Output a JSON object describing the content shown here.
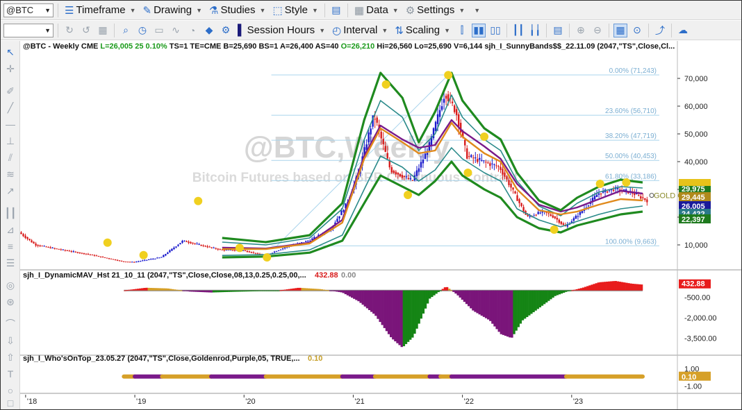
{
  "toolbar": {
    "symbol": "@BTC",
    "menus": [
      "Timeframe",
      "Drawing",
      "Studies",
      "Style",
      "Data",
      "Settings"
    ],
    "row2": [
      "Session Hours",
      "Interval",
      "Scaling"
    ]
  },
  "chart_data": [
    {
      "type": "line",
      "panel": "price",
      "watermark_title": "@BTC,Weekly",
      "watermark_subtitle": "Bitcoin Futures based on BRR Continuous Contract...",
      "header": {
        "symbol": "@BTC - Weekly  CME",
        "L": "L=26,005",
        "chg": "25",
        "pct": "0.10%",
        "rest": "TS=1  TE=CME  B=25,690  BS=1  A=26,400  AS=40",
        "O": "O=26,210",
        "tail": "Hi=26,560  Lo=25,690  V=6,144  sjh_I_SunnyBands$$_22.11.09 (2047,\"TS\",Close,Cl..."
      },
      "ylim": [
        3500,
        80000
      ],
      "y_ticks": [
        10000,
        20000,
        30000,
        40000,
        50000,
        60000,
        70000
      ],
      "y_tick_labels": [
        "10,000",
        "20,000",
        "30,000",
        "40,000",
        "50,000",
        "60,000",
        "70,000"
      ],
      "x_tick_labels": [
        "'18",
        "'19",
        "'20",
        "'21",
        "'22",
        "'23"
      ],
      "x_ticks": [
        2018.0,
        2019.0,
        2020.0,
        2021.0,
        2022.0,
        2023.0
      ],
      "xlim": [
        2017.95,
        2023.93
      ],
      "fib_levels": [
        {
          "label": "0.00% (71,243)",
          "value": 71243
        },
        {
          "label": "23.60% (56,710)",
          "value": 56710
        },
        {
          "label": "38.20% (47,719)",
          "value": 47719
        },
        {
          "label": "50.00% (40,453)",
          "value": 40453
        },
        {
          "label": "61.80% (33,186)",
          "value": 33186
        },
        {
          "label": "100.00% (9,663)",
          "value": 9663
        }
      ],
      "fib_start_x": 2020.25,
      "price_path": {
        "x": [
          2017.95,
          2018.1,
          2018.3,
          2018.6,
          2018.9,
          2019.0,
          2019.25,
          2019.45,
          2019.6,
          2019.8,
          2020.0,
          2020.2,
          2020.4,
          2020.6,
          2020.8,
          2020.95,
          2021.05,
          2021.2,
          2021.35,
          2021.45,
          2021.55,
          2021.7,
          2021.85,
          2021.95,
          2022.05,
          2022.2,
          2022.35,
          2022.45,
          2022.6,
          2022.75,
          2022.85,
          2022.95,
          2023.1,
          2023.25,
          2023.4,
          2023.55,
          2023.7
        ],
        "y": [
          14500,
          10000,
          8500,
          6500,
          4000,
          3800,
          5500,
          11500,
          10000,
          8200,
          8000,
          6200,
          9300,
          11500,
          15500,
          25000,
          35000,
          57000,
          37000,
          35000,
          33000,
          45000,
          65000,
          58000,
          42000,
          40000,
          38000,
          31000,
          20000,
          22000,
          20000,
          16500,
          22000,
          28500,
          30200,
          29000,
          26005
        ]
      },
      "bands": {
        "x": [
          2019.8,
          2020.2,
          2020.6,
          2020.9,
          2021.1,
          2021.25,
          2021.45,
          2021.6,
          2021.75,
          2021.9,
          2022.0,
          2022.2,
          2022.35,
          2022.5,
          2022.7,
          2022.9,
          2023.05,
          2023.25,
          2023.45,
          2023.65
        ],
        "upper2": [
          12500,
          11000,
          13500,
          25000,
          55000,
          72000,
          63000,
          47000,
          58000,
          72000,
          62000,
          52000,
          48000,
          36000,
          26000,
          22500,
          27000,
          31000,
          33500,
          32500
        ],
        "upper1": [
          11000,
          10000,
          12500,
          23000,
          48000,
          62000,
          56000,
          44000,
          50000,
          64000,
          56000,
          48000,
          44000,
          33000,
          24000,
          20500,
          25000,
          29000,
          31000,
          30500
        ],
        "mid_purple": [
          9000,
          8700,
          10800,
          19000,
          42000,
          53000,
          48000,
          45000,
          46000,
          55000,
          51000,
          45500,
          41000,
          32000,
          24500,
          22000,
          23500,
          26500,
          29500,
          28500
        ],
        "mid_orange": [
          8500,
          8500,
          10500,
          18000,
          41000,
          52000,
          47000,
          43000,
          44000,
          54000,
          49000,
          43000,
          40000,
          30000,
          22500,
          21000,
          22000,
          24500,
          26500,
          26000
        ],
        "lower1": [
          6200,
          6500,
          8200,
          13500,
          30000,
          42000,
          38000,
          33000,
          37000,
          45000,
          41000,
          36000,
          33000,
          23000,
          19000,
          16500,
          18500,
          21000,
          23000,
          24000
        ],
        "lower2": [
          5500,
          5800,
          7200,
          11500,
          25000,
          35000,
          31000,
          28000,
          33000,
          40000,
          35000,
          30000,
          27000,
          20000,
          16000,
          14500,
          17000,
          19000,
          21000,
          22000
        ]
      },
      "markers": [
        {
          "x": 2018.75,
          "y": 10800
        },
        {
          "x": 2019.08,
          "y": 6300
        },
        {
          "x": 2019.58,
          "y": 25800
        },
        {
          "x": 2019.96,
          "y": 8900
        },
        {
          "x": 2020.21,
          "y": 5500
        },
        {
          "x": 2021.3,
          "y": 67800
        },
        {
          "x": 2021.5,
          "y": 28000
        },
        {
          "x": 2021.87,
          "y": 71200
        },
        {
          "x": 2022.05,
          "y": 36000
        },
        {
          "x": 2022.2,
          "y": 49000
        },
        {
          "x": 2022.84,
          "y": 15500
        },
        {
          "x": 2023.26,
          "y": 32000
        },
        {
          "x": 2023.5,
          "y": 32500
        }
      ],
      "right_labels": [
        {
          "text": "29,975",
          "value": 31200,
          "bg": "#1e7a1e"
        },
        {
          "text": "29,445",
          "value": 29445,
          "bg": "#b08a1c"
        },
        {
          "text": "26,005",
          "value": 26005,
          "bg": "#1a1a9a"
        },
        {
          "text": "24,422",
          "value": 24000,
          "bg": "#2a7a8a"
        },
        {
          "text": "22,397",
          "value": 22000,
          "bg": "#1e7a1e"
        }
      ],
      "overlay_text": "GOLD ON TO"
    },
    {
      "type": "bar",
      "panel": "indicator1",
      "title": "sjh_I_DynamicMAV_Hst 21_10_11 (2047,\"TS\",Close,Close,08,13,0.25,0.25,00,...",
      "last_value": "432.88",
      "second_value": "0.00",
      "ylim": [
        -4500,
        800
      ],
      "y_tick_labels": [
        "-500.00",
        "-2,000.00",
        "-3,500.00"
      ],
      "y_ticks": [
        -500,
        -2000,
        -3500
      ],
      "profile": {
        "x": [
          2018.9,
          2019.1,
          2019.3,
          2019.5,
          2019.7,
          2019.9,
          2020.1,
          2020.3,
          2020.5,
          2020.7,
          2020.9,
          2021.05,
          2021.2,
          2021.35,
          2021.45,
          2021.55,
          2021.7,
          2021.85,
          2021.95,
          2022.1,
          2022.25,
          2022.35,
          2022.45,
          2022.55,
          2022.7,
          2022.85,
          2022.95,
          2023.1,
          2023.25,
          2023.4,
          2023.55,
          2023.65
        ],
        "y": [
          0,
          200,
          150,
          -80,
          -150,
          -100,
          -60,
          -20,
          200,
          100,
          -150,
          -800,
          -1800,
          -3500,
          -4200,
          -3400,
          -600,
          300,
          -300,
          -1500,
          -2200,
          -3200,
          -3500,
          -2200,
          -1300,
          -400,
          -100,
          200,
          600,
          700,
          500,
          433
        ]
      }
    },
    {
      "type": "bar",
      "panel": "indicator2",
      "title": "sjh_I_Who'sOnTop_23.05.27 (2047,\"TS\",Close,Goldenrod,Purple,05,  TRUE,...",
      "last_value": "0.10",
      "ylim": [
        -1.2,
        1.2
      ],
      "y_tick_labels": [
        "1.00",
        "0.10",
        "-1.00"
      ],
      "y_ticks": [
        1.0,
        0.1,
        -1.0
      ],
      "segments": [
        {
          "from": 2018.9,
          "to": 2019.0,
          "color": "Goldenrod"
        },
        {
          "from": 2019.0,
          "to": 2019.25,
          "color": "Purple"
        },
        {
          "from": 2019.25,
          "to": 2019.7,
          "color": "Goldenrod"
        },
        {
          "from": 2019.7,
          "to": 2020.2,
          "color": "Purple"
        },
        {
          "from": 2020.2,
          "to": 2020.9,
          "color": "Goldenrod"
        },
        {
          "from": 2020.9,
          "to": 2021.2,
          "color": "Purple"
        },
        {
          "from": 2021.2,
          "to": 2021.7,
          "color": "Goldenrod"
        },
        {
          "from": 2021.7,
          "to": 2021.8,
          "color": "Purple"
        },
        {
          "from": 2021.8,
          "to": 2021.9,
          "color": "Goldenrod"
        },
        {
          "from": 2021.9,
          "to": 2022.95,
          "color": "Purple"
        },
        {
          "from": 2022.95,
          "to": 2023.65,
          "color": "Goldenrod"
        }
      ]
    }
  ],
  "colors": {
    "green_band": "#1f8a1f",
    "teal_band": "#2a8a8a",
    "purple_ma": "#7a1a8a",
    "orange_ma": "#e08a1c",
    "up_candle": "#1a1acc",
    "down_candle": "#d81c1c",
    "marker": "#f0d020",
    "fib": "#a8d4ec",
    "hist_green": "#158515",
    "hist_purple": "#7a157a",
    "hist_red": "#e81c1c",
    "hist_gold": "#d6a028"
  }
}
